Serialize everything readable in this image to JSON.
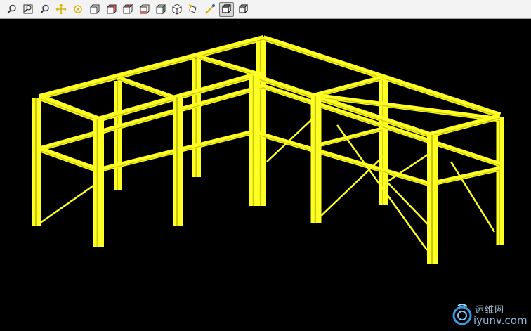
{
  "toolbar": {
    "buttons": [
      {
        "name": "zoom-icon",
        "active": false
      },
      {
        "name": "zoom-window-icon",
        "active": false
      },
      {
        "name": "zoom-dynamic-icon",
        "active": false
      },
      {
        "name": "pan-icon",
        "active": false
      },
      {
        "name": "center-icon",
        "active": false
      },
      {
        "name": "view-front-icon",
        "active": false
      },
      {
        "name": "view-back-icon",
        "active": false
      },
      {
        "name": "view-top-icon",
        "active": false
      },
      {
        "name": "view-bottom-icon",
        "active": false
      },
      {
        "name": "view-left-icon",
        "active": false
      },
      {
        "name": "view-iso-icon",
        "active": false
      },
      {
        "name": "rotate-icon",
        "active": false
      },
      {
        "name": "axes-icon",
        "active": false
      },
      {
        "name": "shaded-cube-icon",
        "active": true
      },
      {
        "name": "wireframe-cube-icon",
        "active": false
      }
    ]
  },
  "viewport": {
    "background": "#000000",
    "member_color": "#ffff24",
    "member_shadow": "#c8c80a"
  },
  "watermark": {
    "chinese": "运维网",
    "domain": "iyunv.com"
  }
}
